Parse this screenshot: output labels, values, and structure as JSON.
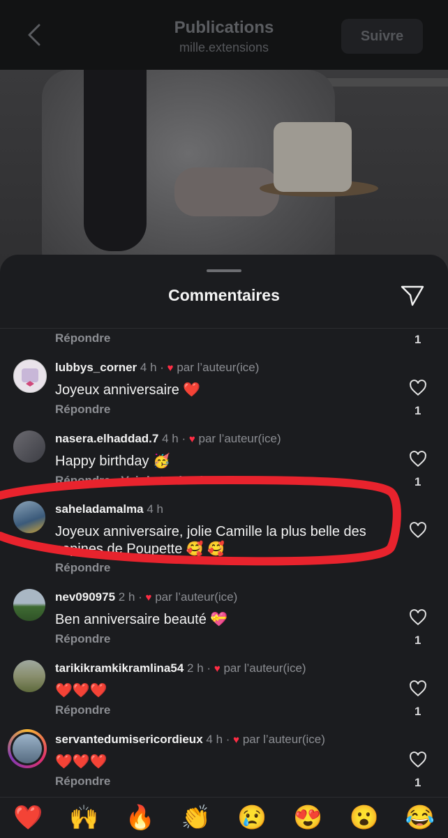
{
  "header": {
    "title": "Publications",
    "subtitle": "mille.extensions",
    "follow_label": "Suivre"
  },
  "sheet": {
    "title": "Commentaires"
  },
  "top_reply": {
    "reply_label": "Répondre",
    "count": "1"
  },
  "comments": [
    {
      "username": "lubbys_corner",
      "time": "4 h",
      "liked_by_author": "par l’auteur(ice)",
      "text": "Joyeux anniversaire ❤️",
      "reply_label": "Répondre",
      "count": "1"
    },
    {
      "username": "nasera.elhaddad.7",
      "time": "4 h",
      "liked_by_author": "par l’auteur(ice)",
      "text": "Happy birthday 🥳",
      "reply_label": "Répondre · Voir la traducti",
      "count": "1"
    },
    {
      "username": "saheladamalma",
      "time": "4 h",
      "liked_by_author": "",
      "text": "Joyeux anniversaire, jolie Camille  la plus belle des copines de Poupette 🥰 🥰",
      "reply_label": "Répondre",
      "count": ""
    },
    {
      "username": "nev090975",
      "time": "2 h",
      "liked_by_author": "par l’auteur(ice)",
      "text": "Ben anniversaire beauté 💝",
      "reply_label": "Répondre",
      "count": "1"
    },
    {
      "username": "tarikikramkikramlina54",
      "time": "2 h",
      "liked_by_author": "par l’auteur(ice)",
      "text": "❤️❤️❤️",
      "reply_label": "Répondre",
      "count": "1"
    },
    {
      "username": "servantedumisericordieux",
      "time": "4 h",
      "liked_by_author": "par l’auteur(ice)",
      "text": "❤️❤️❤️",
      "reply_label": "Répondre",
      "count": "1"
    }
  ],
  "emoji_bar": [
    "❤️",
    "🙌",
    "🔥",
    "👏",
    "😢",
    "😍",
    "😮",
    "😂"
  ],
  "colors": {
    "heart": "#ff2d44",
    "annotation": "#e8232d"
  }
}
